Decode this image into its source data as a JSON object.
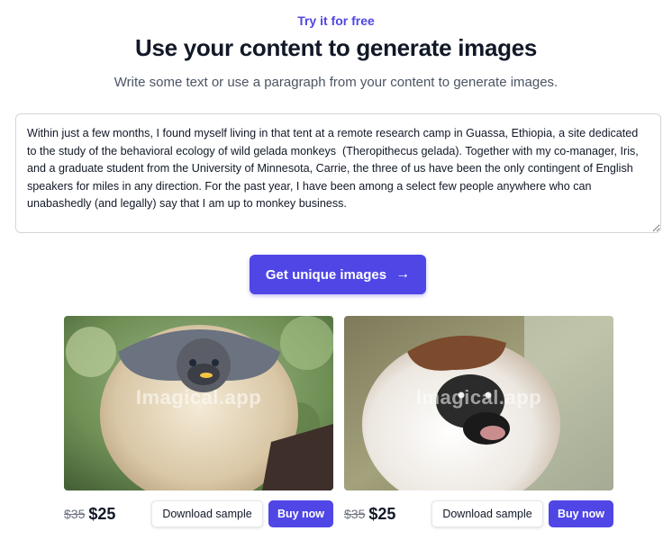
{
  "header": {
    "eyebrow": "Try it for free",
    "title": "Use your content to generate images",
    "subtitle": "Write some text or use a paragraph from your content to generate images."
  },
  "editor": {
    "value": "Within just a few months, I found myself living in that tent at a remote research camp in Guassa, Ethiopia, a site dedicated to the study of the behavioral ecology of wild gelada monkeys  (Theropithecus gelada). Together with my co-manager, Iris, and a graduate student from the University of Minnesota, Carrie, the three of us have been the only contingent of English speakers for miles in any direction. For the past year, I have been among a select few people anywhere who can unabashedly (and legally) say that I am up to monkey business."
  },
  "cta": {
    "label": "Get unique images",
    "icon": "arrow-right-icon"
  },
  "results": [
    {
      "watermark": "Imagical.app",
      "old_price": "$35",
      "price": "$25",
      "download_label": "Download sample",
      "buy_label": "Buy now"
    },
    {
      "watermark": "Imagical.app",
      "old_price": "$35",
      "price": "$25",
      "download_label": "Download sample",
      "buy_label": "Buy now"
    }
  ],
  "colors": {
    "accent": "#4f46e5",
    "text": "#111827",
    "muted": "#4b5563"
  }
}
